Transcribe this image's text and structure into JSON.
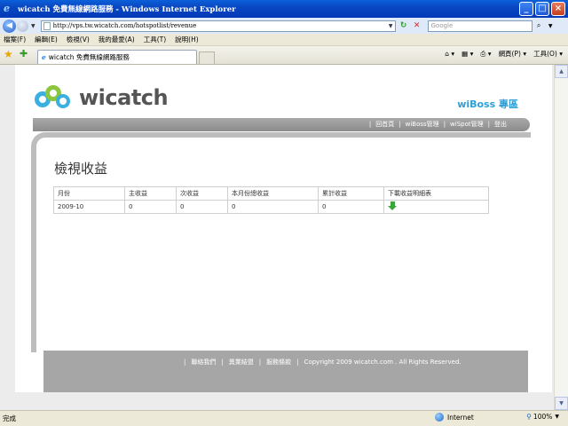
{
  "window": {
    "title": "wicatch 免費無線網路服務 - Windows Internet Explorer"
  },
  "address": {
    "url": "http://vps.tw.wicatch.com/hotspotlist/revenue",
    "search_placeholder": "Google"
  },
  "menubar": [
    "檔案(F)",
    "編輯(E)",
    "檢視(V)",
    "我的最愛(A)",
    "工具(T)",
    "說明(H)"
  ],
  "tab": {
    "label": "wicatch 免費無線網路服務"
  },
  "toolbar": {
    "page_label": "網頁(P) ▾",
    "tools_label": "工具(O) ▾"
  },
  "site": {
    "logo_text": "wicatch",
    "section_title": "wiBoss 專區",
    "nav": [
      "回首頁",
      "wiBoss管理",
      "wiSpot管理",
      "登出"
    ],
    "page_heading": "檢視收益",
    "table": {
      "headers": [
        "月份",
        "主收益",
        "次收益",
        "本月份總收益",
        "累計收益",
        "下載收益明細表"
      ],
      "rows": [
        [
          "2009-10",
          "0",
          "0",
          "0",
          "0"
        ]
      ]
    },
    "footer": {
      "links": [
        "聯絡我們",
        "異業結盟",
        "服務條款"
      ],
      "copyright": "Copyright 2009 wicatch.com . All Rights Reserved."
    }
  },
  "status": {
    "text": "完成",
    "zone": "Internet",
    "zoom": "100%"
  }
}
